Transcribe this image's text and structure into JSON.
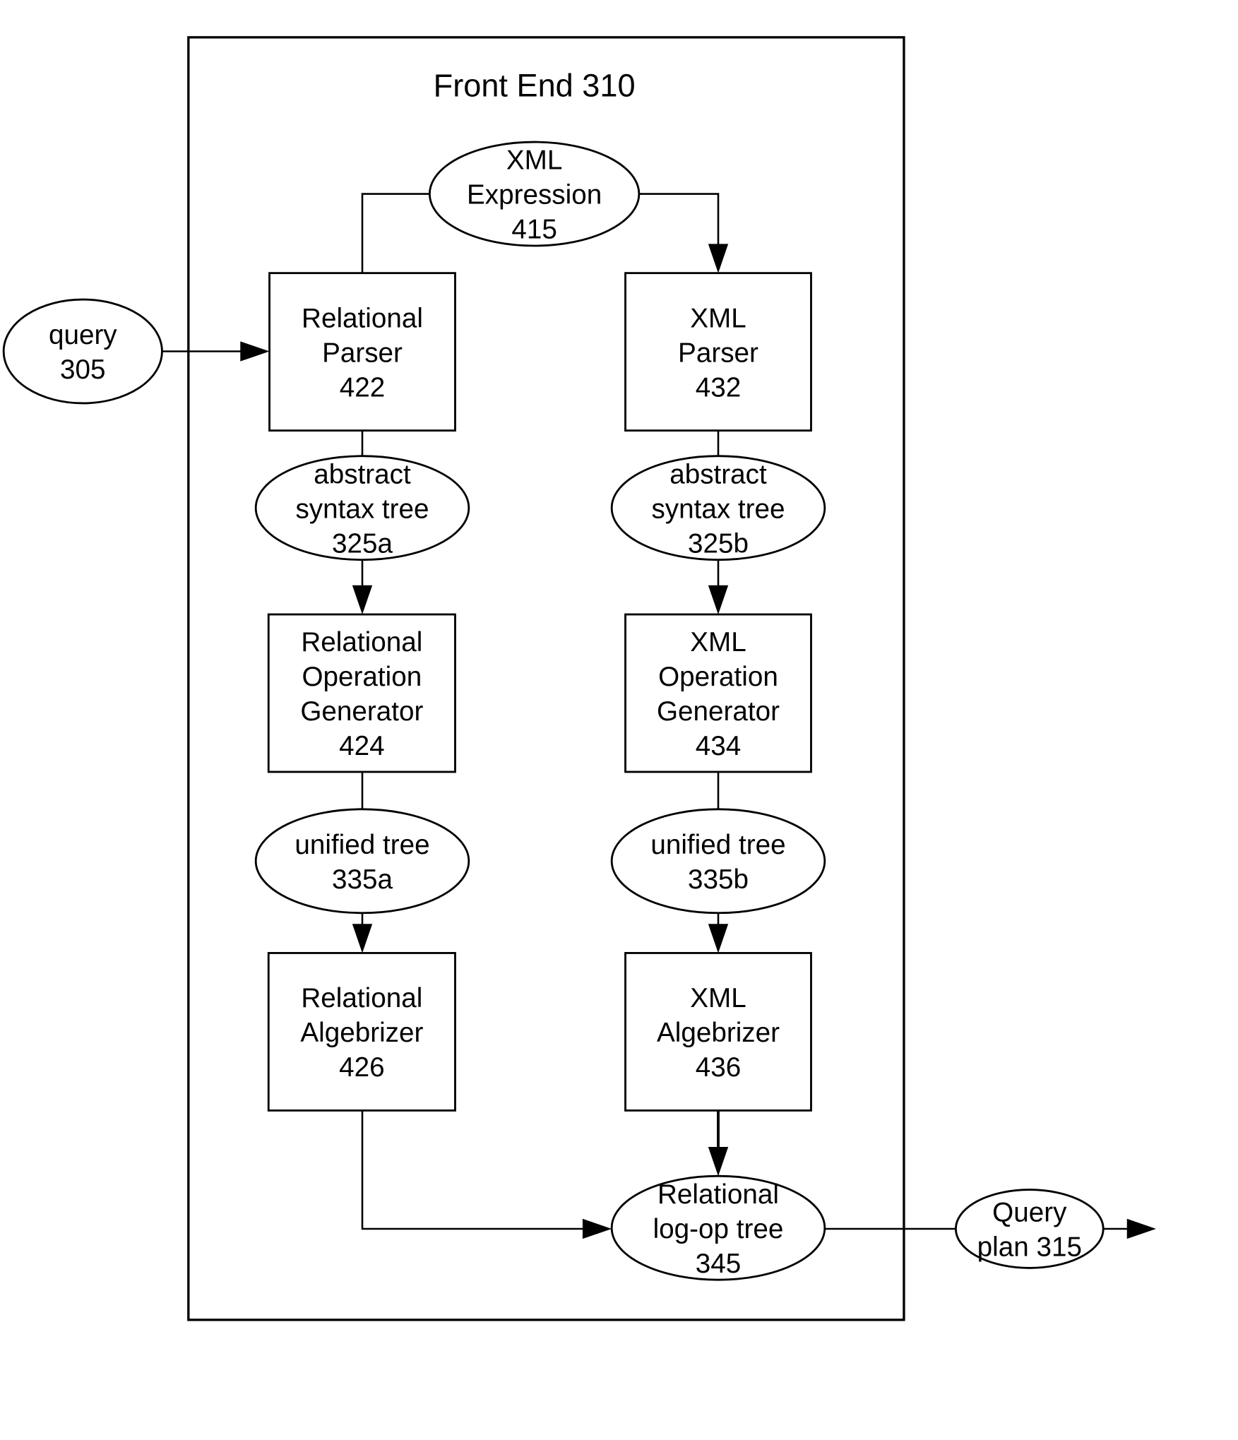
{
  "diagram": {
    "title": "Front End 310",
    "nodes": {
      "query": {
        "shape": "ellipse",
        "lines": [
          "query",
          "305"
        ]
      },
      "xml_expression": {
        "shape": "ellipse",
        "lines": [
          "XML",
          "Expression",
          "415"
        ]
      },
      "relational_parser": {
        "shape": "box",
        "lines": [
          "Relational",
          "Parser",
          "422"
        ]
      },
      "xml_parser": {
        "shape": "box",
        "lines": [
          "XML",
          "Parser",
          "432"
        ]
      },
      "ast_a": {
        "shape": "ellipse",
        "lines": [
          "abstract",
          "syntax tree",
          "325a"
        ]
      },
      "ast_b": {
        "shape": "ellipse",
        "lines": [
          "abstract",
          "syntax tree",
          "325b"
        ]
      },
      "relational_op_gen": {
        "shape": "box",
        "lines": [
          "Relational",
          "Operation",
          "Generator",
          "424"
        ]
      },
      "xml_op_gen": {
        "shape": "box",
        "lines": [
          "XML",
          "Operation",
          "Generator",
          "434"
        ]
      },
      "unified_a": {
        "shape": "ellipse",
        "lines": [
          "unified tree",
          "335a"
        ]
      },
      "unified_b": {
        "shape": "ellipse",
        "lines": [
          "unified tree",
          "335b"
        ]
      },
      "relational_algebrizer": {
        "shape": "box",
        "lines": [
          "Relational",
          "Algebrizer",
          "426"
        ]
      },
      "xml_algebrizer": {
        "shape": "box",
        "lines": [
          "XML",
          "Algebrizer",
          "436"
        ]
      },
      "logop_tree": {
        "shape": "ellipse",
        "lines": [
          "Relational",
          "log-op tree",
          "345"
        ]
      },
      "query_plan": {
        "shape": "ellipse",
        "lines": [
          "Query",
          "plan 315"
        ]
      }
    },
    "edges": [
      {
        "from": "xml_expression",
        "to": "relational_parser",
        "arrow": false
      },
      {
        "from": "xml_expression",
        "to": "xml_parser",
        "arrow": true
      },
      {
        "from": "query",
        "to": "relational_parser",
        "arrow": true
      },
      {
        "from": "relational_parser",
        "to": "ast_a",
        "arrow": false
      },
      {
        "from": "ast_a",
        "to": "relational_op_gen",
        "arrow": true
      },
      {
        "from": "relational_op_gen",
        "to": "unified_a",
        "arrow": false
      },
      {
        "from": "unified_a",
        "to": "relational_algebrizer",
        "arrow": true
      },
      {
        "from": "relational_algebrizer",
        "to": "logop_tree",
        "arrow": true
      },
      {
        "from": "xml_parser",
        "to": "ast_b",
        "arrow": false
      },
      {
        "from": "ast_b",
        "to": "xml_op_gen",
        "arrow": true
      },
      {
        "from": "xml_op_gen",
        "to": "unified_b",
        "arrow": false
      },
      {
        "from": "unified_b",
        "to": "xml_algebrizer",
        "arrow": true
      },
      {
        "from": "xml_algebrizer",
        "to": "logop_tree",
        "arrow": true
      },
      {
        "from": "logop_tree",
        "to": "query_plan",
        "arrow": false
      },
      {
        "from": "query_plan",
        "to": "output",
        "arrow": true
      }
    ]
  }
}
